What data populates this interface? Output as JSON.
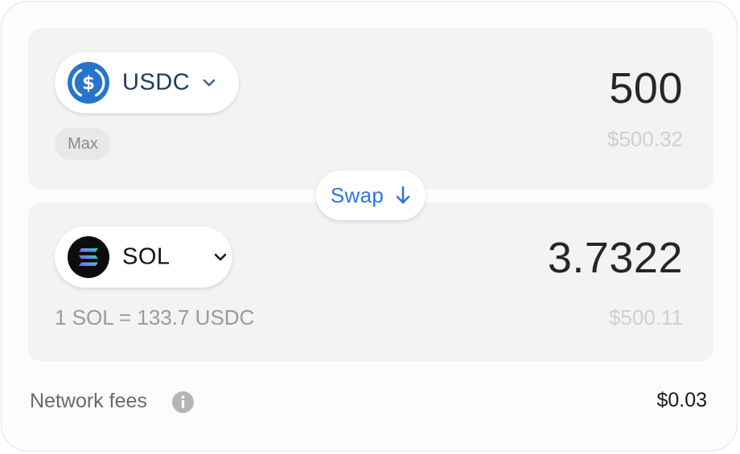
{
  "from": {
    "token": "USDC",
    "token_icon": "usdc-icon",
    "amount": "500",
    "usd_value": "$500.32",
    "max_label": "Max"
  },
  "swap": {
    "label": "Swap",
    "icon": "arrow-down-icon"
  },
  "to": {
    "token": "SOL",
    "token_icon": "sol-icon",
    "amount": "3.7322",
    "usd_value": "$500.11",
    "rate": "1 SOL = 133.7 USDC"
  },
  "fees": {
    "label": "Network fees",
    "value": "$0.03",
    "icon": "info-icon"
  },
  "colors": {
    "accent_blue": "#2c73e6",
    "usdc_blue": "#2775ca",
    "panel_bg": "#f3f3f3"
  }
}
